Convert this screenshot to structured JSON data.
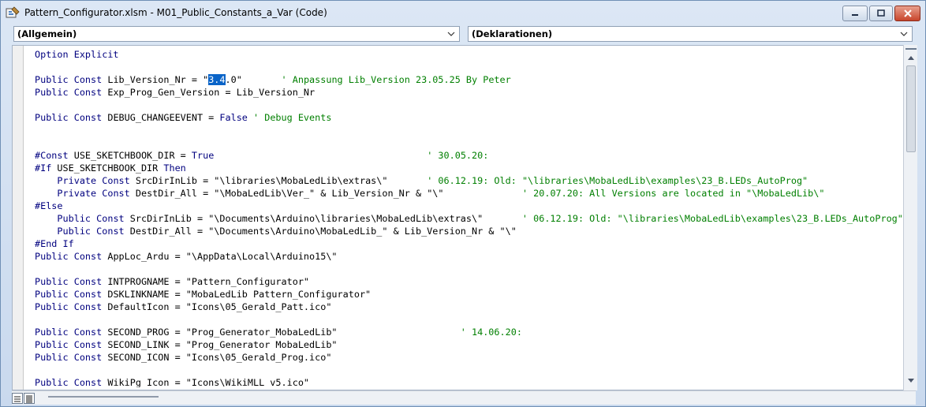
{
  "window": {
    "title": "Pattern_Configurator.xlsm - M01_Public_Constants_a_Var (Code)"
  },
  "selectors": {
    "object": "(Allgemein)",
    "procedure": "(Deklarationen)"
  },
  "code_lines": [
    [
      {
        "t": "Option Explicit",
        "c": "kw"
      }
    ],
    [],
    [
      {
        "t": "Public Const",
        "c": "kw"
      },
      {
        "t": " Lib_Version_Nr = \""
      },
      {
        "t": "3.4",
        "c": "sel"
      },
      {
        "t": ".0\"       "
      },
      {
        "t": "' Anpassung Lib_Version 23.05.25 By Peter",
        "c": "cm"
      }
    ],
    [
      {
        "t": "Public Const",
        "c": "kw"
      },
      {
        "t": " Exp_Prog_Gen_Version = Lib_Version_Nr"
      }
    ],
    [],
    [
      {
        "t": "Public Const",
        "c": "kw"
      },
      {
        "t": " DEBUG_CHANGEEVENT = "
      },
      {
        "t": "False",
        "c": "kw"
      },
      {
        "t": " "
      },
      {
        "t": "' Debug Events",
        "c": "cm"
      }
    ],
    [],
    [],
    [
      {
        "t": "#Const",
        "c": "kw"
      },
      {
        "t": " USE_SKETCHBOOK_DIR = "
      },
      {
        "t": "True",
        "c": "kw"
      },
      {
        "t": "                                      "
      },
      {
        "t": "' 30.05.20:",
        "c": "cm"
      }
    ],
    [
      {
        "t": "#If",
        "c": "kw"
      },
      {
        "t": " USE_SKETCHBOOK_DIR "
      },
      {
        "t": "Then",
        "c": "kw"
      }
    ],
    [
      {
        "t": "    "
      },
      {
        "t": "Private Const",
        "c": "kw"
      },
      {
        "t": " SrcDirInLib = \"\\libraries\\MobaLedLib\\extras\\\"       "
      },
      {
        "t": "' 06.12.19: Old: \"\\libraries\\MobaLedLib\\examples\\23_B.LEDs_AutoProg\"",
        "c": "cm"
      }
    ],
    [
      {
        "t": "    "
      },
      {
        "t": "Private Const",
        "c": "kw"
      },
      {
        "t": " DestDir_All = \"\\MobaLedLib\\Ver_\" & Lib_Version_Nr & \"\\\"              "
      },
      {
        "t": "' 20.07.20: All Versions are located in \"\\MobaLedLib\\\"",
        "c": "cm"
      }
    ],
    [
      {
        "t": "#Else",
        "c": "kw"
      }
    ],
    [
      {
        "t": "    "
      },
      {
        "t": "Public Const",
        "c": "kw"
      },
      {
        "t": " SrcDirInLib = \"\\Documents\\Arduino\\libraries\\MobaLedLib\\extras\\\"       "
      },
      {
        "t": "' 06.12.19: Old: \"\\libraries\\MobaLedLib\\examples\\23_B.LEDs_AutoProg\"",
        "c": "cm"
      }
    ],
    [
      {
        "t": "    "
      },
      {
        "t": "Public Const",
        "c": "kw"
      },
      {
        "t": " DestDir_All = \"\\Documents\\Arduino\\MobaLedLib_\" & Lib_Version_Nr & \"\\\""
      }
    ],
    [
      {
        "t": "#End If",
        "c": "kw"
      }
    ],
    [
      {
        "t": "Public Const",
        "c": "kw"
      },
      {
        "t": " AppLoc_Ardu = \"\\AppData\\Local\\Arduino15\\\""
      }
    ],
    [],
    [
      {
        "t": "Public Const",
        "c": "kw"
      },
      {
        "t": " INTPROGNAME = \"Pattern_Configurator\""
      }
    ],
    [
      {
        "t": "Public Const",
        "c": "kw"
      },
      {
        "t": " DSKLINKNAME = \"MobaLedLib Pattern_Configurator\""
      }
    ],
    [
      {
        "t": "Public Const",
        "c": "kw"
      },
      {
        "t": " DefaultIcon = \"Icons\\05_Gerald_Patt.ico\""
      }
    ],
    [],
    [
      {
        "t": "Public Const",
        "c": "kw"
      },
      {
        "t": " SECOND_PROG = \"Prog_Generator_MobaLedLib\"                      "
      },
      {
        "t": "' 14.06.20:",
        "c": "cm"
      }
    ],
    [
      {
        "t": "Public Const",
        "c": "kw"
      },
      {
        "t": " SECOND_LINK = \"Prog_Generator MobaLedLib\""
      }
    ],
    [
      {
        "t": "Public Const",
        "c": "kw"
      },
      {
        "t": " SECOND_ICON = \"Icons\\05_Gerald_Prog.ico\""
      }
    ],
    [],
    [
      {
        "t": "Public Const",
        "c": "kw"
      },
      {
        "t": " WikiPg_Icon = \"Icons\\WikiMLL_v5.ico\""
      }
    ]
  ]
}
